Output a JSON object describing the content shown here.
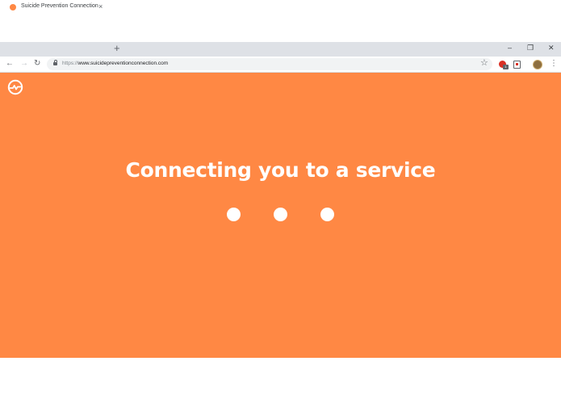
{
  "browser": {
    "tab": {
      "title": "Suicide Prevention Connection",
      "favicon_color": "#ff8844",
      "close_glyph": "×"
    },
    "new_tab_glyph": "+",
    "window_controls": {
      "minimize": "–",
      "restore": "❐",
      "close": "✕"
    },
    "nav": {
      "back": "←",
      "forward": "→",
      "reload": "↻"
    },
    "address": {
      "scheme": "https://",
      "host": "www.suicidepreventionconnection.com"
    },
    "toolbar_icons": {
      "bookmark": "☆",
      "ext_badge": "1",
      "menu": "⋮"
    }
  },
  "page": {
    "background_color": "#ff8844",
    "heading": "Connecting you to a service",
    "loading_dots": 3
  }
}
